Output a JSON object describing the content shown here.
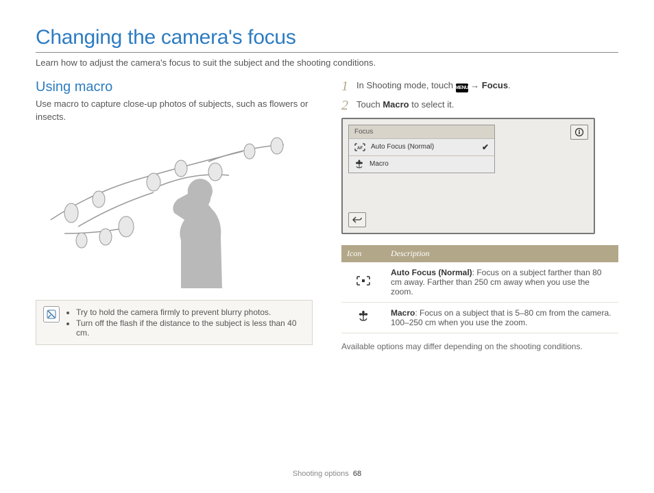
{
  "title": "Changing the camera's focus",
  "lead": "Learn how to adjust the camera's focus to suit the subject and the shooting conditions.",
  "left": {
    "subhead": "Using macro",
    "body": "Use macro to capture close-up photos of subjects, such as flowers or insects.",
    "tips": [
      "Try to hold the camera firmly to prevent blurry photos.",
      "Turn off the flash if the distance to the subject is less than 40 cm."
    ]
  },
  "right": {
    "step1_prefix": "In Shooting mode, touch ",
    "menu_badge": "MENU",
    "arrow": "→",
    "step1_bold": "Focus",
    "step1_suffix": ".",
    "step2_prefix": "Touch ",
    "step2_bold": "Macro",
    "step2_suffix": " to select it.",
    "screen": {
      "menu_title": "Focus",
      "row1": "Auto Focus (Normal)",
      "row2": "Macro"
    },
    "table": {
      "h1": "Icon",
      "h2": "Description",
      "r1_bold": "Auto Focus (Normal)",
      "r1_rest": ": Focus on a subject farther than 80 cm away. Farther than 250 cm away when you use the zoom.",
      "r2_bold": "Macro",
      "r2_rest": ": Focus on a subject that is 5–80 cm from the camera. 100–250 cm when you use the zoom."
    },
    "note": "Available options may differ depending on the shooting conditions."
  },
  "footer": {
    "section": "Shooting options",
    "page": "68"
  }
}
